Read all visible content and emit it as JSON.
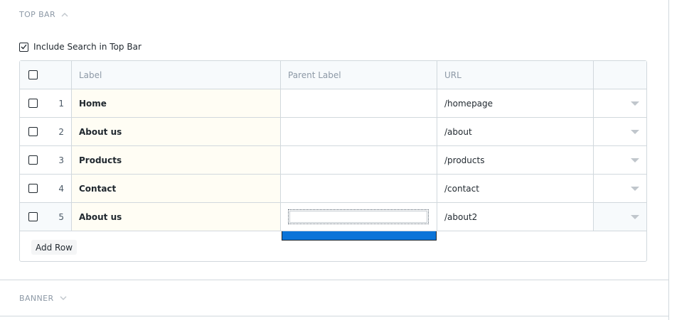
{
  "sections": {
    "top_bar": {
      "title": "TOP BAR",
      "expanded": true
    },
    "banner": {
      "title": "BANNER",
      "expanded": false
    }
  },
  "include_search": {
    "label": "Include Search in Top Bar",
    "checked": true
  },
  "grid": {
    "columns": {
      "label": "Label",
      "parent_label": "Parent Label",
      "url": "URL"
    },
    "rows": [
      {
        "idx": "1",
        "label": "Home",
        "parent_label": "",
        "url": "/homepage"
      },
      {
        "idx": "2",
        "label": "About us",
        "parent_label": "",
        "url": "/about"
      },
      {
        "idx": "3",
        "label": "Products",
        "parent_label": "",
        "url": "/products"
      },
      {
        "idx": "4",
        "label": "Contact",
        "parent_label": "",
        "url": "/contact"
      },
      {
        "idx": "5",
        "label": "About us",
        "parent_label": "",
        "url": "/about2"
      }
    ],
    "add_row_label": "Add Row"
  },
  "colors": {
    "accent": "#0b74d8",
    "border": "#d1d8dd",
    "label_bg": "#fffdf4",
    "muted": "#8d99a6"
  },
  "icons": {
    "collapse": "chevron-up-icon",
    "expand": "chevron-down-icon",
    "row_menu": "caret-down-icon",
    "check": "checkmark-icon"
  }
}
